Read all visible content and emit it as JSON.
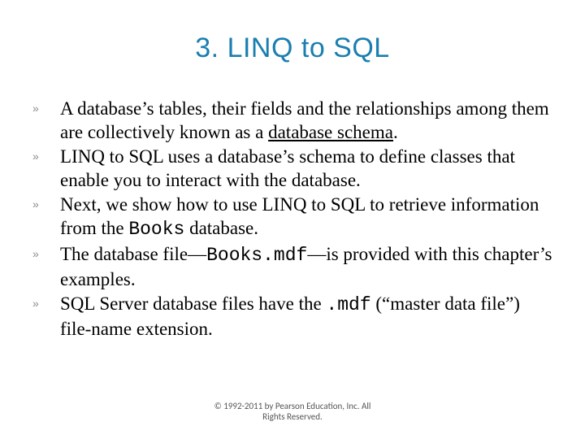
{
  "title": "3. LINQ to SQL",
  "bullets": {
    "b0_pre": "A database’s tables, their fields and the relationships among them are collectively known as a ",
    "b0_u": "database schema",
    "b0_post": ".",
    "b1": "LINQ to SQL uses a database’s schema to define classes that enable you to interact with the database.",
    "b2_pre": "Next, we show how to use LINQ to SQL to retrieve information from the ",
    "b2_m": "Books",
    "b2_post": " database.",
    "b3_pre": "The database file—",
    "b3_m": "Books.mdf",
    "b3_post": "—is provided with this chapter’s examples.",
    "b4_pre": "SQL Server database files have the ",
    "b4_m": ".mdf",
    "b4_post": " (“master data file”) file-name extension."
  },
  "marker": "»",
  "footer": {
    "line1": "© 1992-2011 by Pearson Education, Inc. All",
    "line2": "Rights Reserved."
  }
}
